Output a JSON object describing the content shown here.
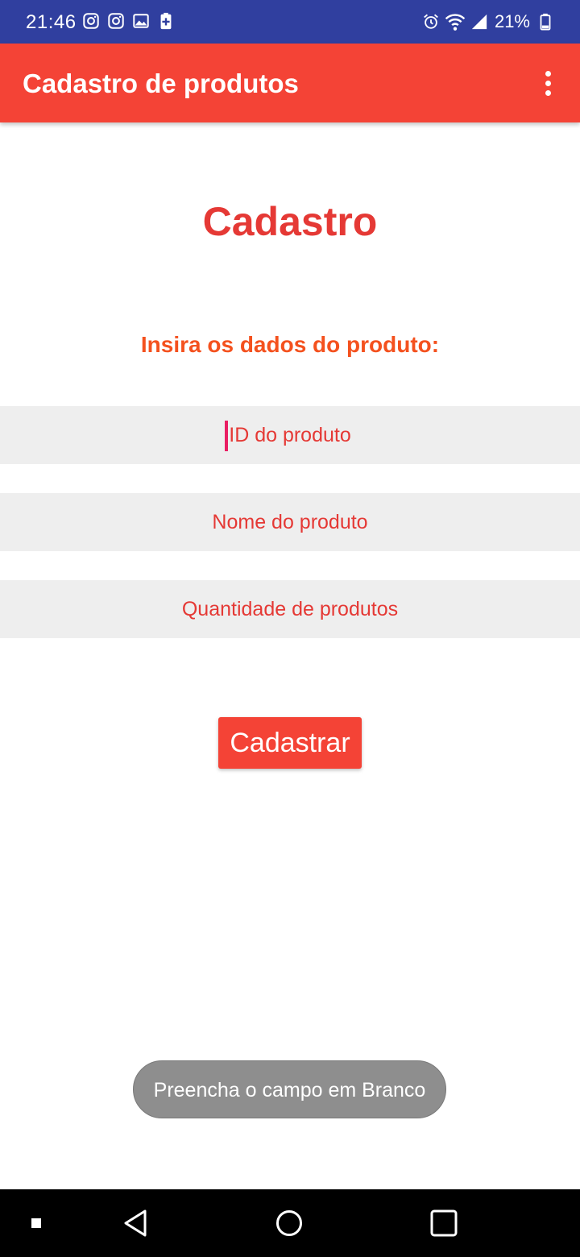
{
  "status_bar": {
    "time": "21:46",
    "battery": "21%",
    "left_icons": [
      "instagram-icon",
      "instagram-icon",
      "gallery-icon",
      "battery-saver-icon"
    ],
    "right_icons": [
      "alarm-icon",
      "wifi-icon",
      "signal-icon",
      "battery-icon"
    ],
    "background": "#303F9F"
  },
  "app_bar": {
    "title": "Cadastro de produtos",
    "menu_icon": "overflow-menu-icon",
    "background": "#F44336"
  },
  "main": {
    "heading": "Cadastro",
    "subheading": "Insira os dados do produto:",
    "fields": {
      "id": {
        "placeholder": "ID do produto",
        "value": ""
      },
      "nome": {
        "placeholder": "Nome do produto",
        "value": ""
      },
      "quantidade": {
        "placeholder": "Quantidade de produtos",
        "value": ""
      }
    },
    "submit_label": "Cadastrar",
    "accent_color": "#E53935"
  },
  "toast": {
    "message": "Preencha o campo em Branco"
  },
  "nav_bar": {
    "icons": [
      "recents-indicator-icon",
      "back-icon",
      "home-icon",
      "overview-icon"
    ]
  }
}
